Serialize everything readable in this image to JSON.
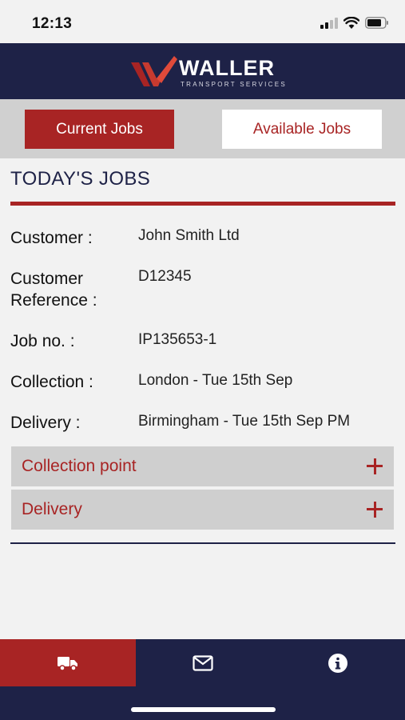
{
  "status_bar": {
    "time": "12:13"
  },
  "header": {
    "logo_word": "WALLER",
    "logo_subtitle": "TRANSPORT SERVICES",
    "brand_colors": {
      "navy": "#1e2247",
      "red": "#a82424"
    }
  },
  "tabs": {
    "current": "Current Jobs",
    "available": "Available Jobs",
    "selected": "current"
  },
  "jobs": {
    "title": "TODAY'S JOBS",
    "fields": [
      {
        "label": "Customer :",
        "value": "John Smith Ltd"
      },
      {
        "label_line1": "Customer",
        "label_line2": "Reference :",
        "value": "D12345"
      },
      {
        "label": "Job no. :",
        "value": "IP135653-1"
      },
      {
        "label": "Collection :",
        "value": "London - Tue 15th Sep"
      },
      {
        "label": "Delivery :",
        "value": "Birmingham - Tue 15th Sep PM"
      }
    ]
  },
  "accordions": [
    {
      "label": "Collection point",
      "icon": "plus-icon"
    },
    {
      "label": "Delivery",
      "icon": "plus-icon"
    }
  ],
  "bottom_nav": {
    "items": [
      {
        "icon": "truck-icon",
        "active": true
      },
      {
        "icon": "envelope-icon",
        "active": false
      },
      {
        "icon": "info-icon",
        "active": false
      }
    ]
  }
}
